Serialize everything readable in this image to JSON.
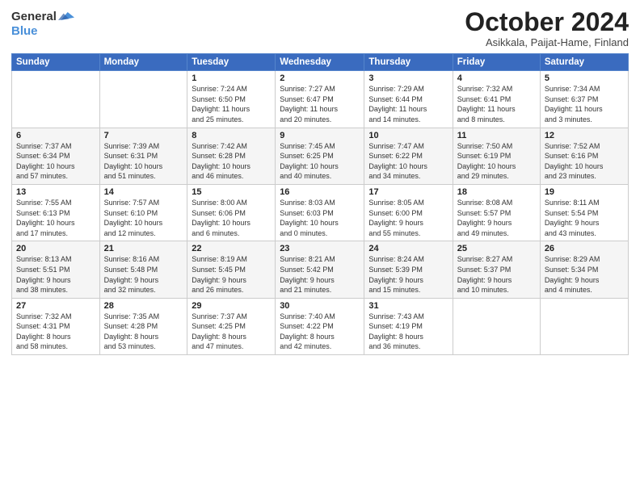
{
  "header": {
    "logo_general": "General",
    "logo_blue": "Blue",
    "month_title": "October 2024",
    "subtitle": "Asikkala, Paijat-Hame, Finland"
  },
  "days_of_week": [
    "Sunday",
    "Monday",
    "Tuesday",
    "Wednesday",
    "Thursday",
    "Friday",
    "Saturday"
  ],
  "weeks": [
    [
      {
        "day": "",
        "info": ""
      },
      {
        "day": "",
        "info": ""
      },
      {
        "day": "1",
        "info": "Sunrise: 7:24 AM\nSunset: 6:50 PM\nDaylight: 11 hours\nand 25 minutes."
      },
      {
        "day": "2",
        "info": "Sunrise: 7:27 AM\nSunset: 6:47 PM\nDaylight: 11 hours\nand 20 minutes."
      },
      {
        "day": "3",
        "info": "Sunrise: 7:29 AM\nSunset: 6:44 PM\nDaylight: 11 hours\nand 14 minutes."
      },
      {
        "day": "4",
        "info": "Sunrise: 7:32 AM\nSunset: 6:41 PM\nDaylight: 11 hours\nand 8 minutes."
      },
      {
        "day": "5",
        "info": "Sunrise: 7:34 AM\nSunset: 6:37 PM\nDaylight: 11 hours\nand 3 minutes."
      }
    ],
    [
      {
        "day": "6",
        "info": "Sunrise: 7:37 AM\nSunset: 6:34 PM\nDaylight: 10 hours\nand 57 minutes."
      },
      {
        "day": "7",
        "info": "Sunrise: 7:39 AM\nSunset: 6:31 PM\nDaylight: 10 hours\nand 51 minutes."
      },
      {
        "day": "8",
        "info": "Sunrise: 7:42 AM\nSunset: 6:28 PM\nDaylight: 10 hours\nand 46 minutes."
      },
      {
        "day": "9",
        "info": "Sunrise: 7:45 AM\nSunset: 6:25 PM\nDaylight: 10 hours\nand 40 minutes."
      },
      {
        "day": "10",
        "info": "Sunrise: 7:47 AM\nSunset: 6:22 PM\nDaylight: 10 hours\nand 34 minutes."
      },
      {
        "day": "11",
        "info": "Sunrise: 7:50 AM\nSunset: 6:19 PM\nDaylight: 10 hours\nand 29 minutes."
      },
      {
        "day": "12",
        "info": "Sunrise: 7:52 AM\nSunset: 6:16 PM\nDaylight: 10 hours\nand 23 minutes."
      }
    ],
    [
      {
        "day": "13",
        "info": "Sunrise: 7:55 AM\nSunset: 6:13 PM\nDaylight: 10 hours\nand 17 minutes."
      },
      {
        "day": "14",
        "info": "Sunrise: 7:57 AM\nSunset: 6:10 PM\nDaylight: 10 hours\nand 12 minutes."
      },
      {
        "day": "15",
        "info": "Sunrise: 8:00 AM\nSunset: 6:06 PM\nDaylight: 10 hours\nand 6 minutes."
      },
      {
        "day": "16",
        "info": "Sunrise: 8:03 AM\nSunset: 6:03 PM\nDaylight: 10 hours\nand 0 minutes."
      },
      {
        "day": "17",
        "info": "Sunrise: 8:05 AM\nSunset: 6:00 PM\nDaylight: 9 hours\nand 55 minutes."
      },
      {
        "day": "18",
        "info": "Sunrise: 8:08 AM\nSunset: 5:57 PM\nDaylight: 9 hours\nand 49 minutes."
      },
      {
        "day": "19",
        "info": "Sunrise: 8:11 AM\nSunset: 5:54 PM\nDaylight: 9 hours\nand 43 minutes."
      }
    ],
    [
      {
        "day": "20",
        "info": "Sunrise: 8:13 AM\nSunset: 5:51 PM\nDaylight: 9 hours\nand 38 minutes."
      },
      {
        "day": "21",
        "info": "Sunrise: 8:16 AM\nSunset: 5:48 PM\nDaylight: 9 hours\nand 32 minutes."
      },
      {
        "day": "22",
        "info": "Sunrise: 8:19 AM\nSunset: 5:45 PM\nDaylight: 9 hours\nand 26 minutes."
      },
      {
        "day": "23",
        "info": "Sunrise: 8:21 AM\nSunset: 5:42 PM\nDaylight: 9 hours\nand 21 minutes."
      },
      {
        "day": "24",
        "info": "Sunrise: 8:24 AM\nSunset: 5:39 PM\nDaylight: 9 hours\nand 15 minutes."
      },
      {
        "day": "25",
        "info": "Sunrise: 8:27 AM\nSunset: 5:37 PM\nDaylight: 9 hours\nand 10 minutes."
      },
      {
        "day": "26",
        "info": "Sunrise: 8:29 AM\nSunset: 5:34 PM\nDaylight: 9 hours\nand 4 minutes."
      }
    ],
    [
      {
        "day": "27",
        "info": "Sunrise: 7:32 AM\nSunset: 4:31 PM\nDaylight: 8 hours\nand 58 minutes."
      },
      {
        "day": "28",
        "info": "Sunrise: 7:35 AM\nSunset: 4:28 PM\nDaylight: 8 hours\nand 53 minutes."
      },
      {
        "day": "29",
        "info": "Sunrise: 7:37 AM\nSunset: 4:25 PM\nDaylight: 8 hours\nand 47 minutes."
      },
      {
        "day": "30",
        "info": "Sunrise: 7:40 AM\nSunset: 4:22 PM\nDaylight: 8 hours\nand 42 minutes."
      },
      {
        "day": "31",
        "info": "Sunrise: 7:43 AM\nSunset: 4:19 PM\nDaylight: 8 hours\nand 36 minutes."
      },
      {
        "day": "",
        "info": ""
      },
      {
        "day": "",
        "info": ""
      }
    ]
  ]
}
